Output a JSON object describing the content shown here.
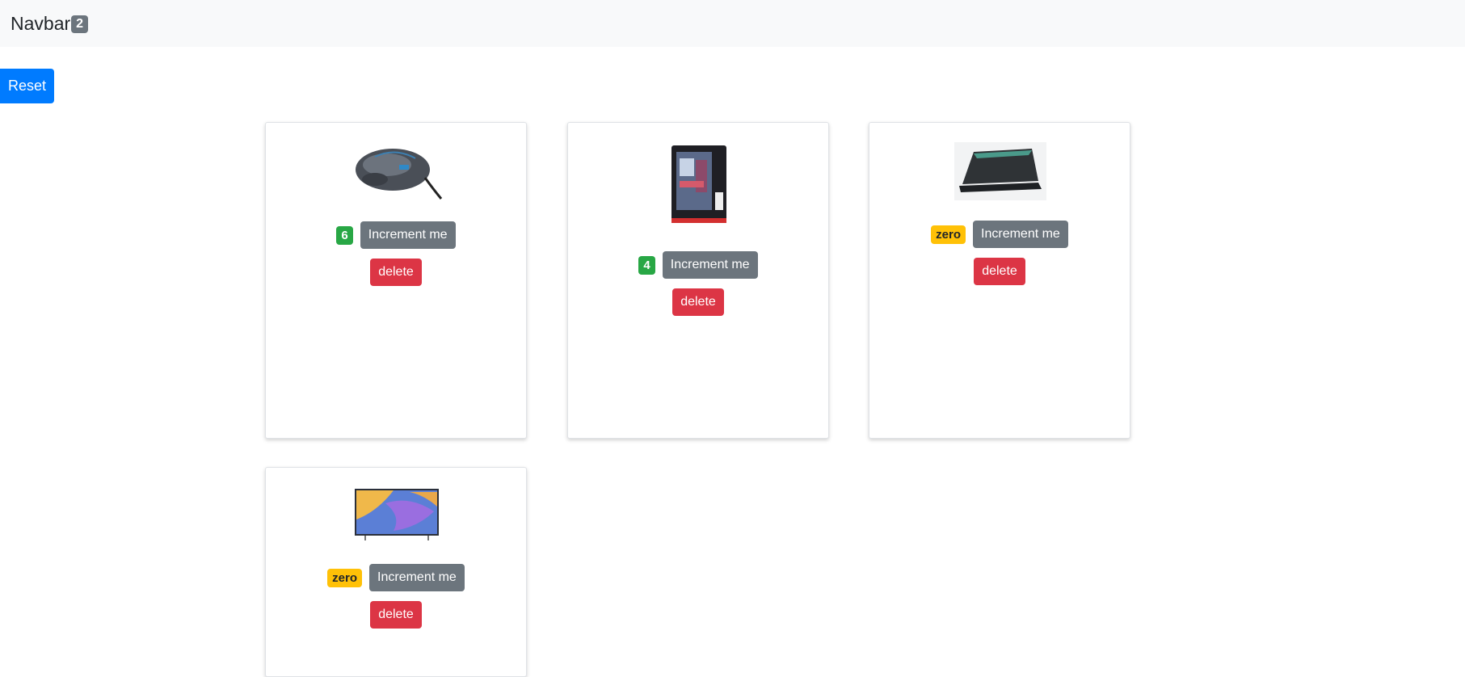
{
  "navbar": {
    "brand": "Navbar",
    "total_count": "2"
  },
  "reset_label": "Reset",
  "products": [
    {
      "name": "mouse",
      "count": "6",
      "increment_label": "Increment me",
      "delete_label": "delete"
    },
    {
      "name": "pc-tower",
      "count": "4",
      "increment_label": "Increment me",
      "delete_label": "delete"
    },
    {
      "name": "laptop",
      "count": "zero",
      "increment_label": "Increment me",
      "delete_label": "delete"
    },
    {
      "name": "tv",
      "count": "zero",
      "increment_label": "Increment me",
      "delete_label": "delete"
    }
  ],
  "colors": {
    "primary": "#007bff",
    "secondary": "#6c757d",
    "success": "#28a745",
    "warning": "#ffc107",
    "danger": "#dc3545"
  }
}
